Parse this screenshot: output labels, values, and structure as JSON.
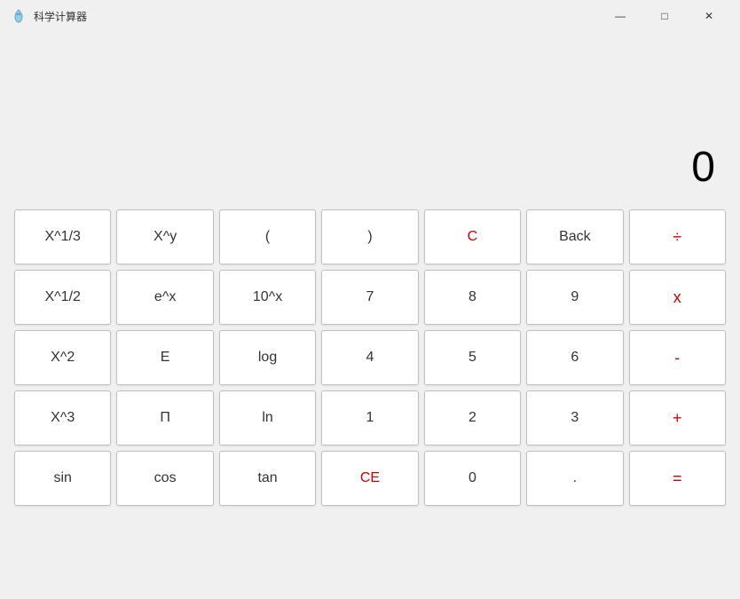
{
  "titleBar": {
    "title": "科学计算器",
    "minimize": "—",
    "maximize": "□",
    "close": "✕"
  },
  "display": {
    "value": "0"
  },
  "buttons": [
    [
      {
        "label": "X^1/3",
        "class": "",
        "name": "btn-x-cbrt"
      },
      {
        "label": "X^y",
        "class": "",
        "name": "btn-x-pow-y"
      },
      {
        "label": "(",
        "class": "",
        "name": "btn-open-paren"
      },
      {
        "label": ")",
        "class": "",
        "name": "btn-close-paren"
      },
      {
        "label": "C",
        "class": "red",
        "name": "btn-clear"
      },
      {
        "label": "Back",
        "class": "",
        "name": "btn-back"
      },
      {
        "label": "÷",
        "class": "operator",
        "name": "btn-divide"
      }
    ],
    [
      {
        "label": "X^1/2",
        "class": "",
        "name": "btn-sqrt"
      },
      {
        "label": "e^x",
        "class": "",
        "name": "btn-exp"
      },
      {
        "label": "10^x",
        "class": "",
        "name": "btn-10pow"
      },
      {
        "label": "7",
        "class": "",
        "name": "btn-7"
      },
      {
        "label": "8",
        "class": "",
        "name": "btn-8"
      },
      {
        "label": "9",
        "class": "",
        "name": "btn-9"
      },
      {
        "label": "x",
        "class": "operator",
        "name": "btn-multiply"
      }
    ],
    [
      {
        "label": "X^2",
        "class": "",
        "name": "btn-x-sq"
      },
      {
        "label": "E",
        "class": "",
        "name": "btn-e"
      },
      {
        "label": "log",
        "class": "",
        "name": "btn-log"
      },
      {
        "label": "4",
        "class": "",
        "name": "btn-4"
      },
      {
        "label": "5",
        "class": "",
        "name": "btn-5"
      },
      {
        "label": "6",
        "class": "",
        "name": "btn-6"
      },
      {
        "label": "-",
        "class": "operator",
        "name": "btn-subtract"
      }
    ],
    [
      {
        "label": "X^3",
        "class": "",
        "name": "btn-x-cube"
      },
      {
        "label": "Π",
        "class": "",
        "name": "btn-pi"
      },
      {
        "label": "ln",
        "class": "",
        "name": "btn-ln"
      },
      {
        "label": "1",
        "class": "",
        "name": "btn-1"
      },
      {
        "label": "2",
        "class": "",
        "name": "btn-2"
      },
      {
        "label": "3",
        "class": "",
        "name": "btn-3"
      },
      {
        "label": "+",
        "class": "operator",
        "name": "btn-add"
      }
    ],
    [
      {
        "label": "sin",
        "class": "",
        "name": "btn-sin"
      },
      {
        "label": "cos",
        "class": "",
        "name": "btn-cos"
      },
      {
        "label": "tan",
        "class": "",
        "name": "btn-tan"
      },
      {
        "label": "CE",
        "class": "red",
        "name": "btn-ce"
      },
      {
        "label": "0",
        "class": "",
        "name": "btn-0"
      },
      {
        "label": ".",
        "class": "",
        "name": "btn-dot"
      },
      {
        "label": "=",
        "class": "operator",
        "name": "btn-equals"
      }
    ]
  ]
}
